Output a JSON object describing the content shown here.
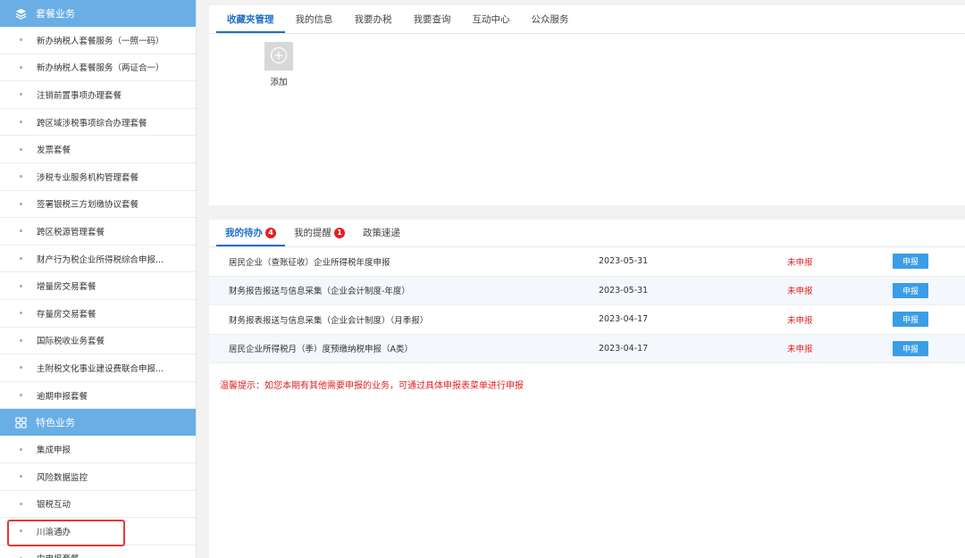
{
  "sidebar": {
    "section1": {
      "title": "套餐业务",
      "icon": "layers-icon",
      "items": [
        "新办纳税人套餐服务（一照一码）",
        "新办纳税人套餐服务（两证合一）",
        "注销前置事项办理套餐",
        "跨区域涉税事项综合办理套餐",
        "发票套餐",
        "涉税专业服务机构管理套餐",
        "签署银税三方划缴协议套餐",
        "跨区税源管理套餐",
        "财产行为税企业所得税综合申报...",
        "增量房交易套餐",
        "存量房交易套餐",
        "国际税收业务套餐",
        "主附税文化事业建设费联合申报...",
        "逾期申报套餐"
      ]
    },
    "section2": {
      "title": "特色业务",
      "icon": "grid-icon",
      "items": [
        "集成申报",
        "风险数据监控",
        "银税互动",
        "川渝通办",
        "中申报套餐"
      ]
    }
  },
  "top_tabs": [
    "收藏夹管理",
    "我的信息",
    "我要办税",
    "我要查询",
    "互动中心",
    "公众服务"
  ],
  "favorites": {
    "add_label": "添加"
  },
  "bottom_tabs": [
    {
      "label": "我的待办",
      "badge": "4"
    },
    {
      "label": "我的提醒",
      "badge": "1"
    },
    {
      "label": "政策速递",
      "badge": ""
    }
  ],
  "todo_rows": [
    {
      "name": "居民企业（查账征收）企业所得税年度申报",
      "date": "2023-05-31",
      "status": "未申报",
      "action": "申报"
    },
    {
      "name": "财务报告报送与信息采集（企业会计制度-年度）",
      "date": "2023-05-31",
      "status": "未申报",
      "action": "申报"
    },
    {
      "name": "财务报表报送与信息采集（企业会计制度）（月季报）",
      "date": "2023-04-17",
      "status": "未申报",
      "action": "申报"
    },
    {
      "name": "居民企业所得税月（季）度预缴纳税申报（A类）",
      "date": "2023-04-17",
      "status": "未申报",
      "action": "申报"
    }
  ],
  "tip": "温馨提示：如您本期有其他需要申报的业务，可通过具体申报表菜单进行申报",
  "colors": {
    "accent": "#1e6ec8",
    "sidebar_header": "#6aaee6",
    "alert": "#e02020",
    "button": "#3b9de6"
  }
}
